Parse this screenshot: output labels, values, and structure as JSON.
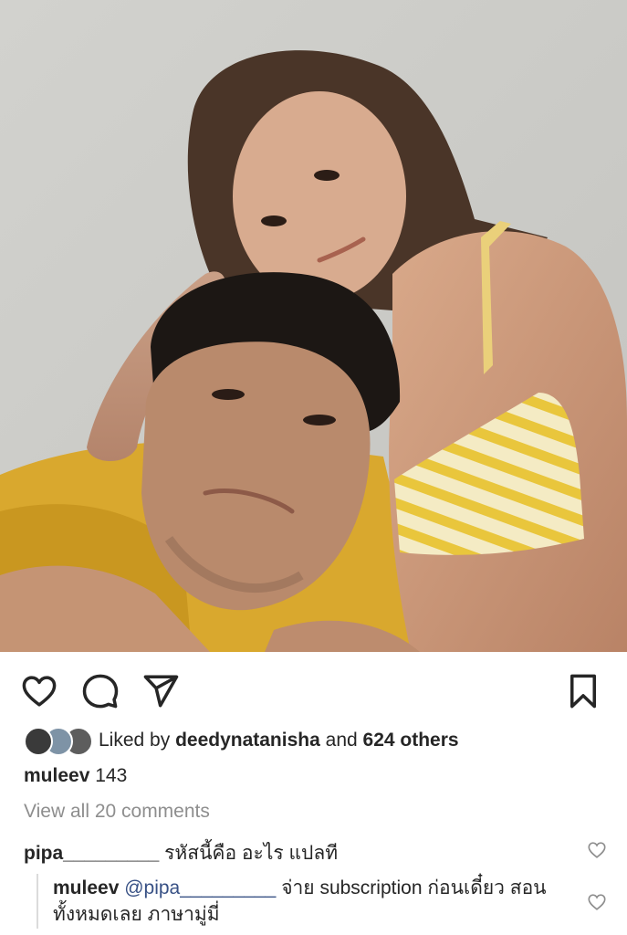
{
  "post": {
    "liked_by_prefix": "Liked by",
    "liked_by_user": "deedynatanisha",
    "liked_by_mid": "and",
    "liked_by_others": "624 others",
    "caption_user": "muleev",
    "caption_text": "143",
    "view_all_comments": "View all 20 comments"
  },
  "comments": [
    {
      "user": "pipa_________",
      "text": "รหัสนี้คือ อะไร แปลที"
    },
    {
      "user": "muleev",
      "mention": "@pipa_________",
      "text": "จ่าย subscription ก่อนเดี๋ยว สอนทั้งหมดเลย ภาษามู่มี่"
    }
  ],
  "icons": {
    "like": "heart-icon",
    "comment": "comment-bubble-icon",
    "share": "paper-plane-icon",
    "save": "bookmark-icon",
    "comment_like": "heart-icon"
  },
  "colors": {
    "text": "#262626",
    "muted": "#8e8e8e",
    "mention": "#385185",
    "reply_bar": "#dbdbdb",
    "photo_wall": "#cfcfcb",
    "sofa": "#d9a82e",
    "bikini": "#efd24a"
  }
}
